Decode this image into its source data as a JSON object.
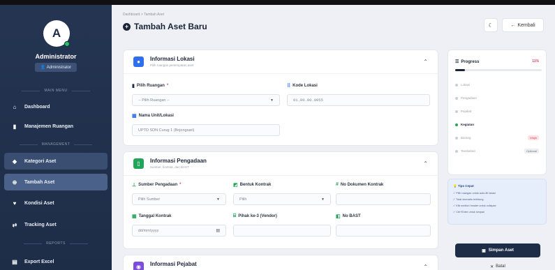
{
  "sidebar": {
    "avatar_letter": "A",
    "user_name": "Administrator",
    "role": "Administrator",
    "sections": {
      "main": "MAIN MENU",
      "management": "MANAGEMENT",
      "reports": "REPORTS"
    },
    "items": [
      {
        "label": "Dashboard",
        "icon": "home-icon"
      },
      {
        "label": "Manajemen Ruangan",
        "icon": "door-icon"
      },
      {
        "label": "Kategori Aset",
        "icon": "tags-icon"
      },
      {
        "label": "Tambah Aset",
        "icon": "plus-circle-icon"
      },
      {
        "label": "Kondisi Aset",
        "icon": "heart-icon"
      },
      {
        "label": "Tracking Aset",
        "icon": "route-icon"
      },
      {
        "label": "Export Excel",
        "icon": "excel-icon"
      }
    ]
  },
  "header": {
    "breadcrumb": "Dashboard > Tambah Aset",
    "title": "Tambah Aset Baru",
    "back_label": "Kembali"
  },
  "lokasi": {
    "title": "Informasi Lokasi",
    "subtitle": "Pilih ruangan penempatan aset",
    "ruangan_label": "Pilih Ruangan",
    "ruangan_value": "-- Pilih Ruangan --",
    "kode_label": "Kode Lokasi",
    "kode_value": "01.00.00.0055",
    "unit_label": "Nama Unit/Lokasi",
    "unit_value": "UPTD SDN Curug 1 (Bojongsari)"
  },
  "pengadaan": {
    "title": "Informasi Pengadaan",
    "subtitle": "Sumber, kontrak, dan BAST",
    "sumber_label": "Sumber Pengadaan",
    "sumber_value": "Pilih Sumber",
    "bentuk_label": "Bentuk Kontrak",
    "bentuk_value": "Pilih",
    "dokumen_label": "No Dokumen Kontrak",
    "tanggal_label": "Tanggal Kontrak",
    "tanggal_placeholder": "dd/mm/yyyy",
    "pihak_label": "Pihak ke-3 (Vendor)",
    "bast_label": "No BAST"
  },
  "pejabat": {
    "title": "Informasi Pejabat"
  },
  "progress": {
    "title": "Progress",
    "percent_label": "11%",
    "percent": 0.11,
    "steps": [
      {
        "label": "Lokasi",
        "active": false
      },
      {
        "label": "Pengadaan",
        "active": false
      },
      {
        "label": "Pejabat",
        "active": false
      },
      {
        "label": "Kegiatan",
        "active": true
      },
      {
        "label": "Barang",
        "active": false,
        "badge": "Wajib"
      },
      {
        "label": "Tambahan",
        "active": false,
        "badge": "Optional"
      }
    ]
  },
  "tips": {
    "title": "Tips Cepat",
    "items": [
      "Pilih ruangan untuk auto-fill lokasi",
      "Total otomatis terhitung",
      "Klik section header untuk collapse",
      "Ctrl+Enter untuk simpan"
    ]
  },
  "actions": {
    "save_label": "Simpan Aset",
    "cancel_label": "Batal"
  },
  "colors": {
    "sidebar": "#1e2d47",
    "accent_blue": "#2f6fed",
    "accent_green": "#22a559",
    "accent_purple": "#7c4ddb"
  }
}
